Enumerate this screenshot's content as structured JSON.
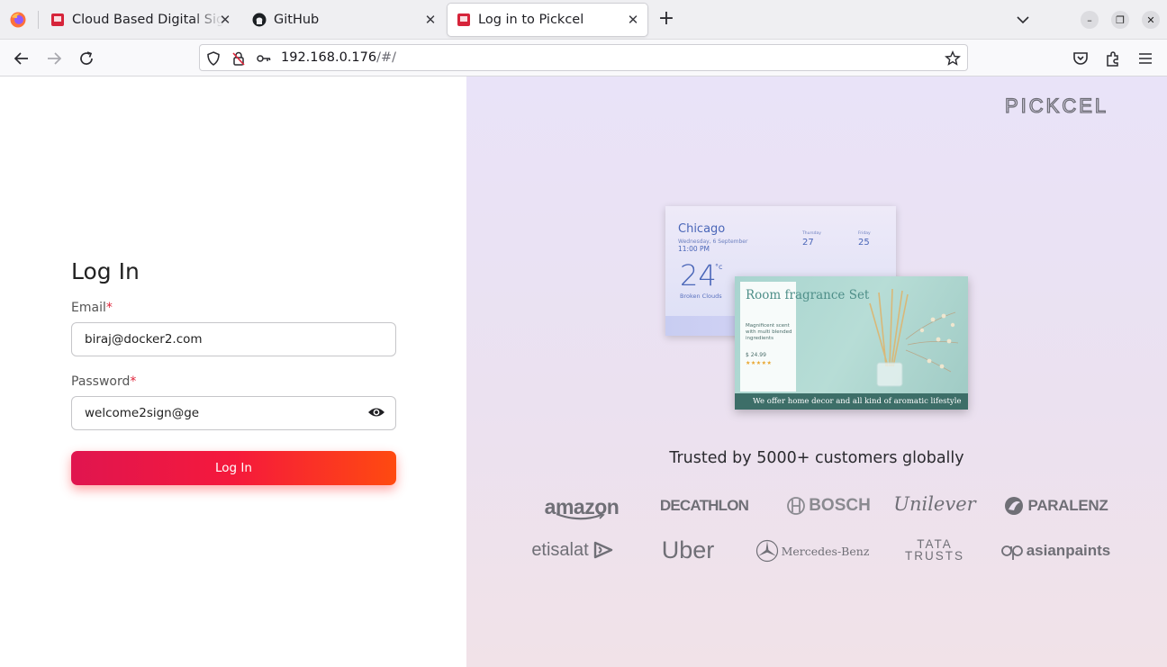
{
  "browser": {
    "tabs": [
      {
        "title": "Cloud Based Digital Signage",
        "active": false
      },
      {
        "title": "GitHub",
        "active": false
      },
      {
        "title": "Log in to Pickcel",
        "active": true
      }
    ],
    "url_host": "192.168.0.176",
    "url_path": "/#/"
  },
  "login": {
    "heading": "Log In",
    "email_label": "Email",
    "email_value": "biraj@docker2.com",
    "password_label": "Password",
    "password_value": "welcome2sign@ge",
    "required_mark": "*",
    "submit_label": "Log In"
  },
  "promo": {
    "brand": "PICKCEL",
    "trusted_text": "Trusted by 5000+ customers globally",
    "weather_screen": {
      "city": "Chicago",
      "date": "Wednesday, 6 September",
      "time": "11:00 PM",
      "temperature": "24",
      "unit": "°c",
      "condition": "Broken Clouds",
      "day1": "Thursday",
      "temp1": "27",
      "day2": "Friday",
      "temp2": "25"
    },
    "product_screen": {
      "title": "Room fragrance Set",
      "description": "Magnificent scent with multi blended ingredients",
      "price": "$ 24.99",
      "stars": "★★★★★",
      "footer": "We offer home decor and all kind of aromatic lifestyle"
    },
    "customer_logos": [
      "amazon",
      "DECATHLON",
      "BOSCH",
      "Unilever",
      "PARALENZ",
      "etisalat",
      "Uber",
      "Mercedes-Benz",
      "TATA TRUSTS",
      "asianpaints"
    ],
    "accent": "#f5193c"
  }
}
